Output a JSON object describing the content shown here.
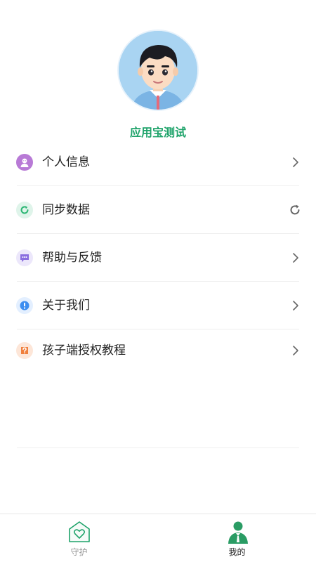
{
  "profile": {
    "username": "应用宝测试",
    "username_color": "#1ea36a"
  },
  "menu": [
    {
      "label": "个人信息",
      "icon": "user-icon",
      "icon_bg": "#b87ad6",
      "right": "chevron"
    },
    {
      "label": "同步数据",
      "icon": "sync-icon",
      "icon_bg": "#dff4ea",
      "right": "refresh"
    },
    {
      "label": "帮助与反馈",
      "icon": "chat-icon",
      "icon_bg": "#ece7fb",
      "right": "chevron"
    },
    {
      "label": "关于我们",
      "icon": "info-icon",
      "icon_bg": "#e3efff",
      "right": "chevron"
    },
    {
      "label": "孩子端授权教程",
      "icon": "question-icon",
      "icon_bg": "#fde6d8",
      "right": "chevron"
    }
  ],
  "tabbar": {
    "tabs": [
      {
        "label": "守护",
        "icon": "heart-shield-icon",
        "active": false
      },
      {
        "label": "我的",
        "icon": "person-icon",
        "active": true
      }
    ],
    "active_color": "#1ea36a",
    "inactive_color": "#999999"
  }
}
